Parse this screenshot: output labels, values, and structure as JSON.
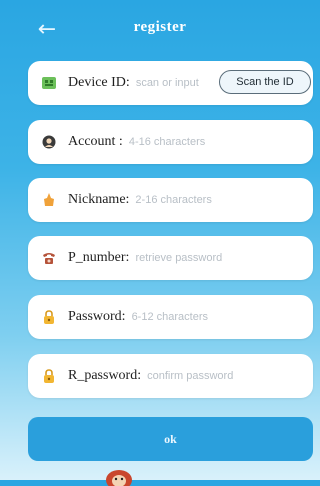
{
  "header": {
    "back_icon": "arrow-left-icon",
    "title": "register"
  },
  "form": {
    "fields": [
      {
        "id": "device",
        "icon": "qr-card-icon",
        "label": "Device ID:",
        "placeholder": "scan or input",
        "button": "Scan the ID"
      },
      {
        "id": "account",
        "icon": "user-icon",
        "label": "Account :",
        "placeholder": "4-16 characters"
      },
      {
        "id": "nickname",
        "icon": "thumbs-up-icon",
        "label": "Nickname:",
        "placeholder": "2-16 characters"
      },
      {
        "id": "phone",
        "icon": "phone-icon",
        "label": "P_number:",
        "placeholder": "retrieve password"
      },
      {
        "id": "password",
        "icon": "lock-icon",
        "label": "Password:",
        "placeholder": "6-12 characters"
      },
      {
        "id": "confirm",
        "icon": "lock-icon",
        "label": "R_password:",
        "placeholder": "confirm password"
      }
    ]
  },
  "submit": {
    "label": "ok"
  },
  "colors": {
    "accent": "#2a9fdc",
    "background_top": "#2aa6e2",
    "background_bottom": "#d9f1fb"
  }
}
